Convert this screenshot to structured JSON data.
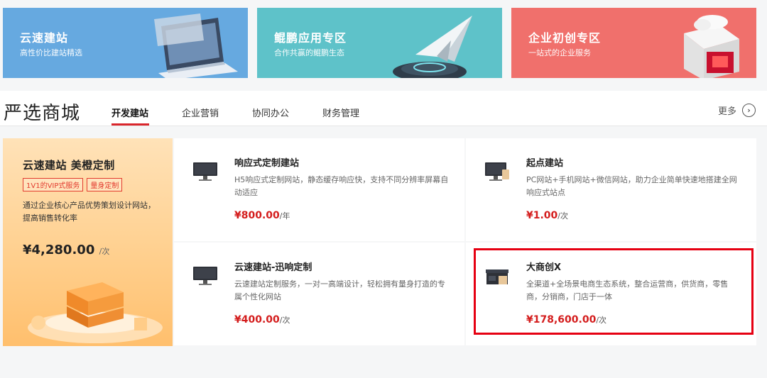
{
  "banners": [
    {
      "title": "云速建站",
      "subtitle": "高性价比建站精选"
    },
    {
      "title": "鲲鹏应用专区",
      "subtitle": "合作共赢的鲲鹏生态"
    },
    {
      "title": "企业初创专区",
      "subtitle": "一站式的企业服务"
    }
  ],
  "section": {
    "title": "严选商城",
    "tabs": [
      "开发建站",
      "企业营销",
      "协同办公",
      "财务管理"
    ],
    "active_tab": "开发建站",
    "more_label": "更多"
  },
  "promo": {
    "title": "云速建站 美橙定制",
    "tags": [
      "1V1的VIP式服务",
      "量身定制"
    ],
    "description": "通过企业核心产品优势策划设计网站，提高销售转化率",
    "price": "¥4,280.00",
    "unit": "/次"
  },
  "products": [
    {
      "title": "响应式定制建站",
      "description": "H5响应式定制网站，静态缓存响应快，支持不同分辨率屏幕自动适应",
      "price": "¥800.00",
      "unit": "/年",
      "icon": "monitor-icon"
    },
    {
      "title": "起点建站",
      "description": "PC网站+手机网站+微信网站，助力企业简单快速地搭建全网响应式站点",
      "price": "¥1.00",
      "unit": "/次",
      "icon": "monitor-phone-icon"
    },
    {
      "title": "云速建站-迅响定制",
      "description": "云速建站定制服务，一对一高端设计，轻松拥有量身打造的专属个性化网站",
      "price": "¥400.00",
      "unit": "/次",
      "icon": "monitor-icon"
    },
    {
      "title": "大商创X",
      "description": "全渠道+全场景电商生态系统，整合运营商，供货商，零售商，分销商，门店于一体",
      "price": "¥178,600.00",
      "unit": "/次",
      "icon": "storefront-icon"
    }
  ],
  "colors": {
    "accent": "#d9262c",
    "price": "#d41d1d",
    "highlight": "#e60012"
  }
}
